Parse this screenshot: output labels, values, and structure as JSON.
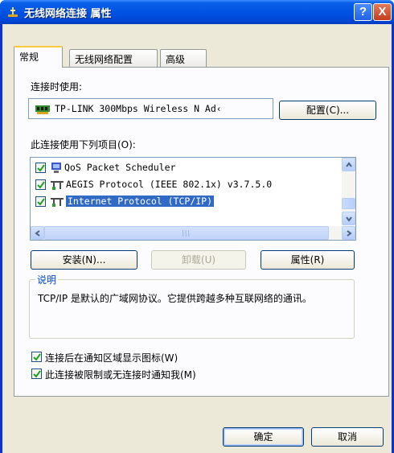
{
  "window": {
    "title": "无线网络连接 属性",
    "help_button": "?",
    "close_button": "X"
  },
  "tabs": [
    {
      "label": "常规",
      "active": true
    },
    {
      "label": "无线网络配置",
      "active": false
    },
    {
      "label": "高级",
      "active": false
    }
  ],
  "general": {
    "connect_using_label": "连接时使用:",
    "adapter_name": "TP-LINK 300Mbps Wireless N Ad‹",
    "configure_button": "配置(C)...",
    "items_label": "此连接使用下列项目(O):",
    "items": [
      {
        "label": "QoS Packet Scheduler",
        "checked": true,
        "icon": "network-service-icon",
        "selected": false
      },
      {
        "label": "AEGIS Protocol (IEEE 802.1x) v3.7.5.0",
        "checked": true,
        "icon": "network-protocol-icon",
        "selected": false
      },
      {
        "label": "Internet Protocol (TCP/IP)",
        "checked": true,
        "icon": "network-protocol-icon",
        "selected": true
      }
    ],
    "install_button": "安装(N)...",
    "uninstall_button": "卸载(U)",
    "properties_button": "属性(R)",
    "description_title": "说明",
    "description_text": "TCP/IP 是默认的广域网协议。它提供跨越多种互联网络的通讯。",
    "show_icon_label": "连接后在通知区域显示图标(W)",
    "show_icon_checked": true,
    "notify_label": "此连接被限制或无连接时通知我(M)",
    "notify_checked": true
  },
  "footer": {
    "ok_button": "确定",
    "cancel_button": "取消"
  },
  "colors": {
    "titlebar": "#0054e3",
    "dialog_bg": "#ece9d8",
    "selection": "#316ac5",
    "group_title": "#0046d5"
  }
}
